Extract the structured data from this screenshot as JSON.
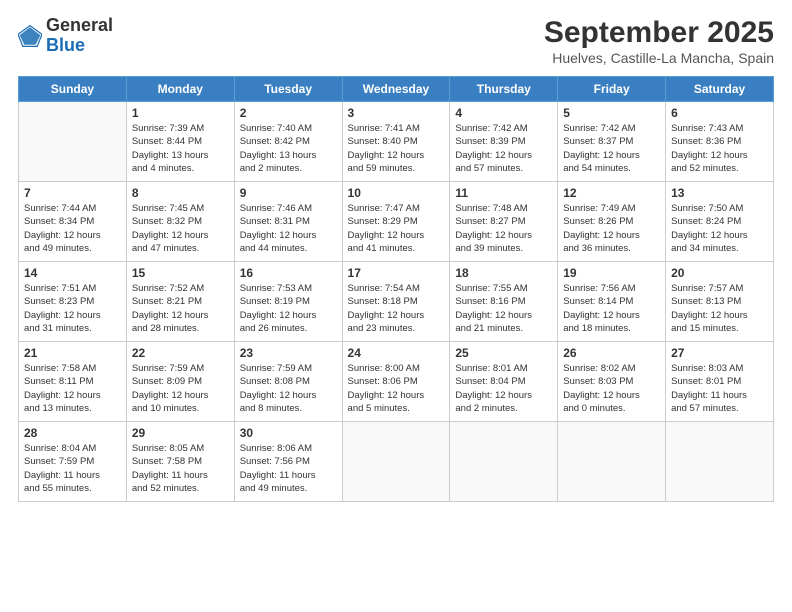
{
  "logo": {
    "line1": "General",
    "line2": "Blue"
  },
  "title": "September 2025",
  "subtitle": "Huelves, Castille-La Mancha, Spain",
  "days_of_week": [
    "Sunday",
    "Monday",
    "Tuesday",
    "Wednesday",
    "Thursday",
    "Friday",
    "Saturday"
  ],
  "weeks": [
    [
      {
        "day": "",
        "info": ""
      },
      {
        "day": "1",
        "info": "Sunrise: 7:39 AM\nSunset: 8:44 PM\nDaylight: 13 hours\nand 4 minutes."
      },
      {
        "day": "2",
        "info": "Sunrise: 7:40 AM\nSunset: 8:42 PM\nDaylight: 13 hours\nand 2 minutes."
      },
      {
        "day": "3",
        "info": "Sunrise: 7:41 AM\nSunset: 8:40 PM\nDaylight: 12 hours\nand 59 minutes."
      },
      {
        "day": "4",
        "info": "Sunrise: 7:42 AM\nSunset: 8:39 PM\nDaylight: 12 hours\nand 57 minutes."
      },
      {
        "day": "5",
        "info": "Sunrise: 7:42 AM\nSunset: 8:37 PM\nDaylight: 12 hours\nand 54 minutes."
      },
      {
        "day": "6",
        "info": "Sunrise: 7:43 AM\nSunset: 8:36 PM\nDaylight: 12 hours\nand 52 minutes."
      }
    ],
    [
      {
        "day": "7",
        "info": "Sunrise: 7:44 AM\nSunset: 8:34 PM\nDaylight: 12 hours\nand 49 minutes."
      },
      {
        "day": "8",
        "info": "Sunrise: 7:45 AM\nSunset: 8:32 PM\nDaylight: 12 hours\nand 47 minutes."
      },
      {
        "day": "9",
        "info": "Sunrise: 7:46 AM\nSunset: 8:31 PM\nDaylight: 12 hours\nand 44 minutes."
      },
      {
        "day": "10",
        "info": "Sunrise: 7:47 AM\nSunset: 8:29 PM\nDaylight: 12 hours\nand 41 minutes."
      },
      {
        "day": "11",
        "info": "Sunrise: 7:48 AM\nSunset: 8:27 PM\nDaylight: 12 hours\nand 39 minutes."
      },
      {
        "day": "12",
        "info": "Sunrise: 7:49 AM\nSunset: 8:26 PM\nDaylight: 12 hours\nand 36 minutes."
      },
      {
        "day": "13",
        "info": "Sunrise: 7:50 AM\nSunset: 8:24 PM\nDaylight: 12 hours\nand 34 minutes."
      }
    ],
    [
      {
        "day": "14",
        "info": "Sunrise: 7:51 AM\nSunset: 8:23 PM\nDaylight: 12 hours\nand 31 minutes."
      },
      {
        "day": "15",
        "info": "Sunrise: 7:52 AM\nSunset: 8:21 PM\nDaylight: 12 hours\nand 28 minutes."
      },
      {
        "day": "16",
        "info": "Sunrise: 7:53 AM\nSunset: 8:19 PM\nDaylight: 12 hours\nand 26 minutes."
      },
      {
        "day": "17",
        "info": "Sunrise: 7:54 AM\nSunset: 8:18 PM\nDaylight: 12 hours\nand 23 minutes."
      },
      {
        "day": "18",
        "info": "Sunrise: 7:55 AM\nSunset: 8:16 PM\nDaylight: 12 hours\nand 21 minutes."
      },
      {
        "day": "19",
        "info": "Sunrise: 7:56 AM\nSunset: 8:14 PM\nDaylight: 12 hours\nand 18 minutes."
      },
      {
        "day": "20",
        "info": "Sunrise: 7:57 AM\nSunset: 8:13 PM\nDaylight: 12 hours\nand 15 minutes."
      }
    ],
    [
      {
        "day": "21",
        "info": "Sunrise: 7:58 AM\nSunset: 8:11 PM\nDaylight: 12 hours\nand 13 minutes."
      },
      {
        "day": "22",
        "info": "Sunrise: 7:59 AM\nSunset: 8:09 PM\nDaylight: 12 hours\nand 10 minutes."
      },
      {
        "day": "23",
        "info": "Sunrise: 7:59 AM\nSunset: 8:08 PM\nDaylight: 12 hours\nand 8 minutes."
      },
      {
        "day": "24",
        "info": "Sunrise: 8:00 AM\nSunset: 8:06 PM\nDaylight: 12 hours\nand 5 minutes."
      },
      {
        "day": "25",
        "info": "Sunrise: 8:01 AM\nSunset: 8:04 PM\nDaylight: 12 hours\nand 2 minutes."
      },
      {
        "day": "26",
        "info": "Sunrise: 8:02 AM\nSunset: 8:03 PM\nDaylight: 12 hours\nand 0 minutes."
      },
      {
        "day": "27",
        "info": "Sunrise: 8:03 AM\nSunset: 8:01 PM\nDaylight: 11 hours\nand 57 minutes."
      }
    ],
    [
      {
        "day": "28",
        "info": "Sunrise: 8:04 AM\nSunset: 7:59 PM\nDaylight: 11 hours\nand 55 minutes."
      },
      {
        "day": "29",
        "info": "Sunrise: 8:05 AM\nSunset: 7:58 PM\nDaylight: 11 hours\nand 52 minutes."
      },
      {
        "day": "30",
        "info": "Sunrise: 8:06 AM\nSunset: 7:56 PM\nDaylight: 11 hours\nand 49 minutes."
      },
      {
        "day": "",
        "info": ""
      },
      {
        "day": "",
        "info": ""
      },
      {
        "day": "",
        "info": ""
      },
      {
        "day": "",
        "info": ""
      }
    ]
  ]
}
